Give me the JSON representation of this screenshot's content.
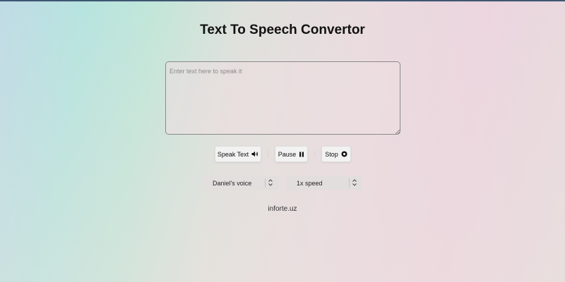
{
  "header": {
    "title": "Text To Speech Convertor"
  },
  "input": {
    "placeholder": "Enter text here to speak it",
    "value": ""
  },
  "controls": {
    "speak_label": "Speak Text",
    "speak_icon": "speaker-volume-icon",
    "pause_label": "Pause",
    "pause_icon": "pause-icon",
    "stop_label": "Stop",
    "stop_icon": "stop-circle-icon"
  },
  "selects": {
    "voice": {
      "selected": "Daniel's voice",
      "icon": "chevron-up-down-icon"
    },
    "speed": {
      "selected": "1x speed",
      "icon": "chevron-up-down-icon"
    }
  },
  "footer": {
    "text": "inforte.uz"
  },
  "colors": {
    "top_rule": "#3e5672",
    "title": "#111111",
    "button_bg": "#f3f2f2"
  }
}
